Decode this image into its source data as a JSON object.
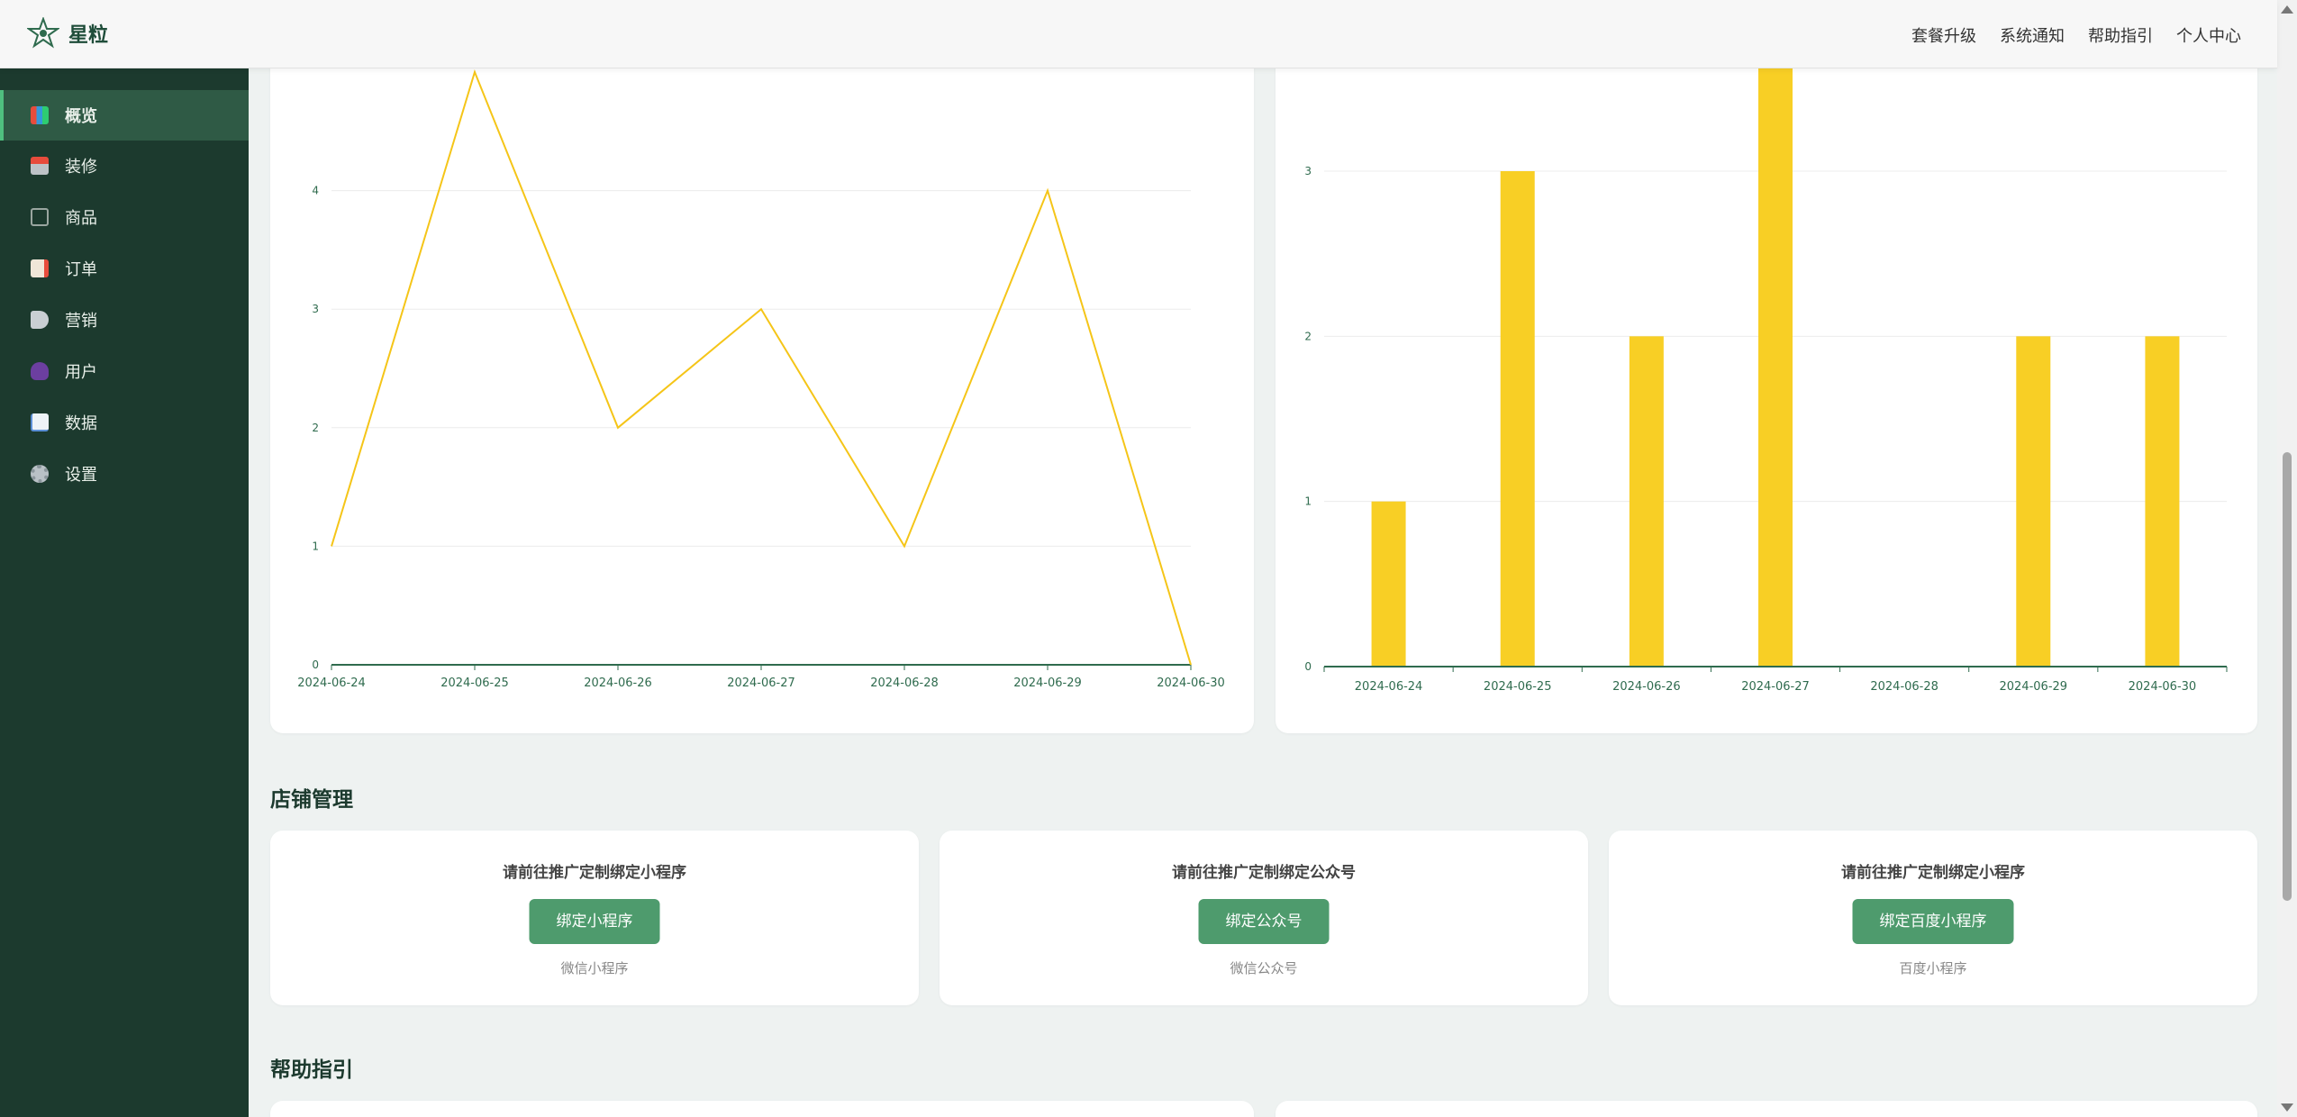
{
  "header": {
    "brand": "星粒",
    "nav": [
      "套餐升级",
      "系统通知",
      "帮助指引",
      "个人中心"
    ]
  },
  "sidebar": {
    "items": [
      {
        "label": "概览",
        "icon": "chart-icon",
        "active": true
      },
      {
        "label": "装修",
        "icon": "store-icon"
      },
      {
        "label": "商品",
        "icon": "product-icon"
      },
      {
        "label": "订单",
        "icon": "order-icon"
      },
      {
        "label": "营销",
        "icon": "speaker-icon"
      },
      {
        "label": "用户",
        "icon": "user-icon"
      },
      {
        "label": "数据",
        "icon": "trend-icon"
      },
      {
        "label": "设置",
        "icon": "gear-icon"
      }
    ]
  },
  "chart_data": [
    {
      "type": "line",
      "x": [
        "2024-06-24",
        "2024-06-25",
        "2024-06-26",
        "2024-06-27",
        "2024-06-28",
        "2024-06-29",
        "2024-06-30"
      ],
      "values": [
        1,
        5,
        2,
        3,
        1,
        4,
        0
      ],
      "yticks": [
        0,
        1,
        2,
        3,
        4
      ],
      "ylim": [
        0,
        5
      ],
      "color": "#f5c518",
      "grid": true
    },
    {
      "type": "bar",
      "categories": [
        "2024-06-24",
        "2024-06-25",
        "2024-06-26",
        "2024-06-27",
        "2024-06-28",
        "2024-06-29",
        "2024-06-30"
      ],
      "values": [
        1,
        3,
        2,
        4,
        0,
        2,
        2
      ],
      "yticks": [
        0,
        1,
        2,
        3
      ],
      "ylim": [
        0,
        3.6
      ],
      "color": "#f8cf25",
      "grid": true
    }
  ],
  "store": {
    "title": "店铺管理",
    "cards": [
      {
        "title": "请前往推广定制绑定小程序",
        "button": "绑定小程序",
        "sub": "微信小程序"
      },
      {
        "title": "请前往推广定制绑定公众号",
        "button": "绑定公众号",
        "sub": "微信公众号"
      },
      {
        "title": "请前往推广定制绑定小程序",
        "button": "绑定百度小程序",
        "sub": "百度小程序"
      }
    ]
  },
  "help": {
    "title": "帮助指引"
  }
}
